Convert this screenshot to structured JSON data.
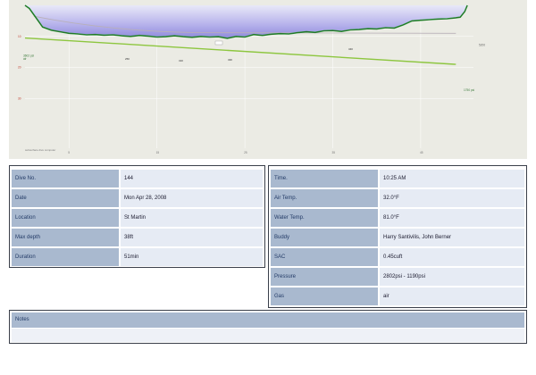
{
  "colors": {
    "panel_key_bg": "#a9b9cf",
    "panel_value_bg": "#e6ebf4",
    "depth_line": "#39b54a",
    "gas_line": "#8dc63f",
    "plot_bg": "#ebebe4"
  },
  "chart_data": {
    "type": "line",
    "title": "",
    "xlabel": "",
    "ylabel": "",
    "xlim": [
      0,
      51
    ],
    "ylim": [
      0,
      46
    ],
    "x_ticks": [
      "5",
      "15",
      "25",
      "35",
      "45"
    ],
    "y_ticks": [
      "10",
      "20",
      "30"
    ],
    "series": [
      {
        "name": "",
        "x": [
          0,
          0.5,
          1,
          1.5,
          2,
          3,
          4,
          5,
          6,
          7,
          8,
          9,
          10,
          11,
          12,
          13,
          14,
          15,
          16,
          17,
          18,
          19,
          20,
          21,
          22,
          23,
          24,
          25,
          26,
          27,
          28,
          29,
          30,
          31,
          32,
          33,
          34,
          35,
          36,
          37,
          38,
          39,
          40,
          41,
          42,
          43,
          44,
          45,
          46,
          47,
          48,
          49,
          49.5,
          50,
          50.3
        ],
        "y": [
          0,
          1,
          3,
          5,
          7,
          8,
          8.5,
          9,
          9.2,
          9.5,
          9.4,
          9.6,
          9.5,
          9.8,
          10,
          9.7,
          9.9,
          10.2,
          10.1,
          9.8,
          10.1,
          10.3,
          10,
          10.2,
          10.1,
          10.6,
          10,
          10.2,
          9.4,
          9.7,
          9.3,
          9.1,
          9.2,
          8.8,
          8.5,
          8.7,
          8.2,
          8.1,
          8.4,
          7.9,
          7.8,
          7.5,
          7.6,
          7.2,
          7.3,
          6.3,
          5,
          4.8,
          4.6,
          4.4,
          4.3,
          4,
          3.8,
          2,
          0
        ]
      }
    ],
    "gas_line": {
      "x": [
        0,
        49
      ],
      "y": [
        10.5,
        19
      ]
    },
    "avg_depth_line": {
      "x": [
        0,
        49
      ],
      "y": [
        7.5,
        9
      ]
    },
    "labels": {
      "label_left_top": "3602 psi",
      "label_left_air": "air",
      "label_right_gas": "1750 psi",
      "label_right_avg": "5200",
      "bottom_left_note": "subsurface dive computer",
      "peak_markers": [
        "25ft",
        "31ft",
        "33ft",
        "34ft"
      ]
    }
  },
  "left_table": [
    {
      "label": "Dive No.",
      "value": "144"
    },
    {
      "label": "Date",
      "value": "Mon Apr 28, 2008"
    },
    {
      "label": "Location",
      "value": "St Martin"
    },
    {
      "label": "Max depth",
      "value": "38ft"
    },
    {
      "label": "Duration",
      "value": "51min"
    }
  ],
  "right_table": [
    {
      "label": "Time.",
      "value": "10:25 AM"
    },
    {
      "label": "Air Temp.",
      "value": "32.0°F"
    },
    {
      "label": "Water Temp.",
      "value": "81.0°F"
    },
    {
      "label": "Buddy",
      "value": "Harry Santivilis, John Berner"
    },
    {
      "label": "SAC",
      "value": "0.45cuft"
    },
    {
      "label": "Pressure",
      "value": "2802psi - 1190psi"
    },
    {
      "label": "Gas",
      "value": "air"
    }
  ],
  "notes": {
    "label": "Notes",
    "text": ""
  }
}
